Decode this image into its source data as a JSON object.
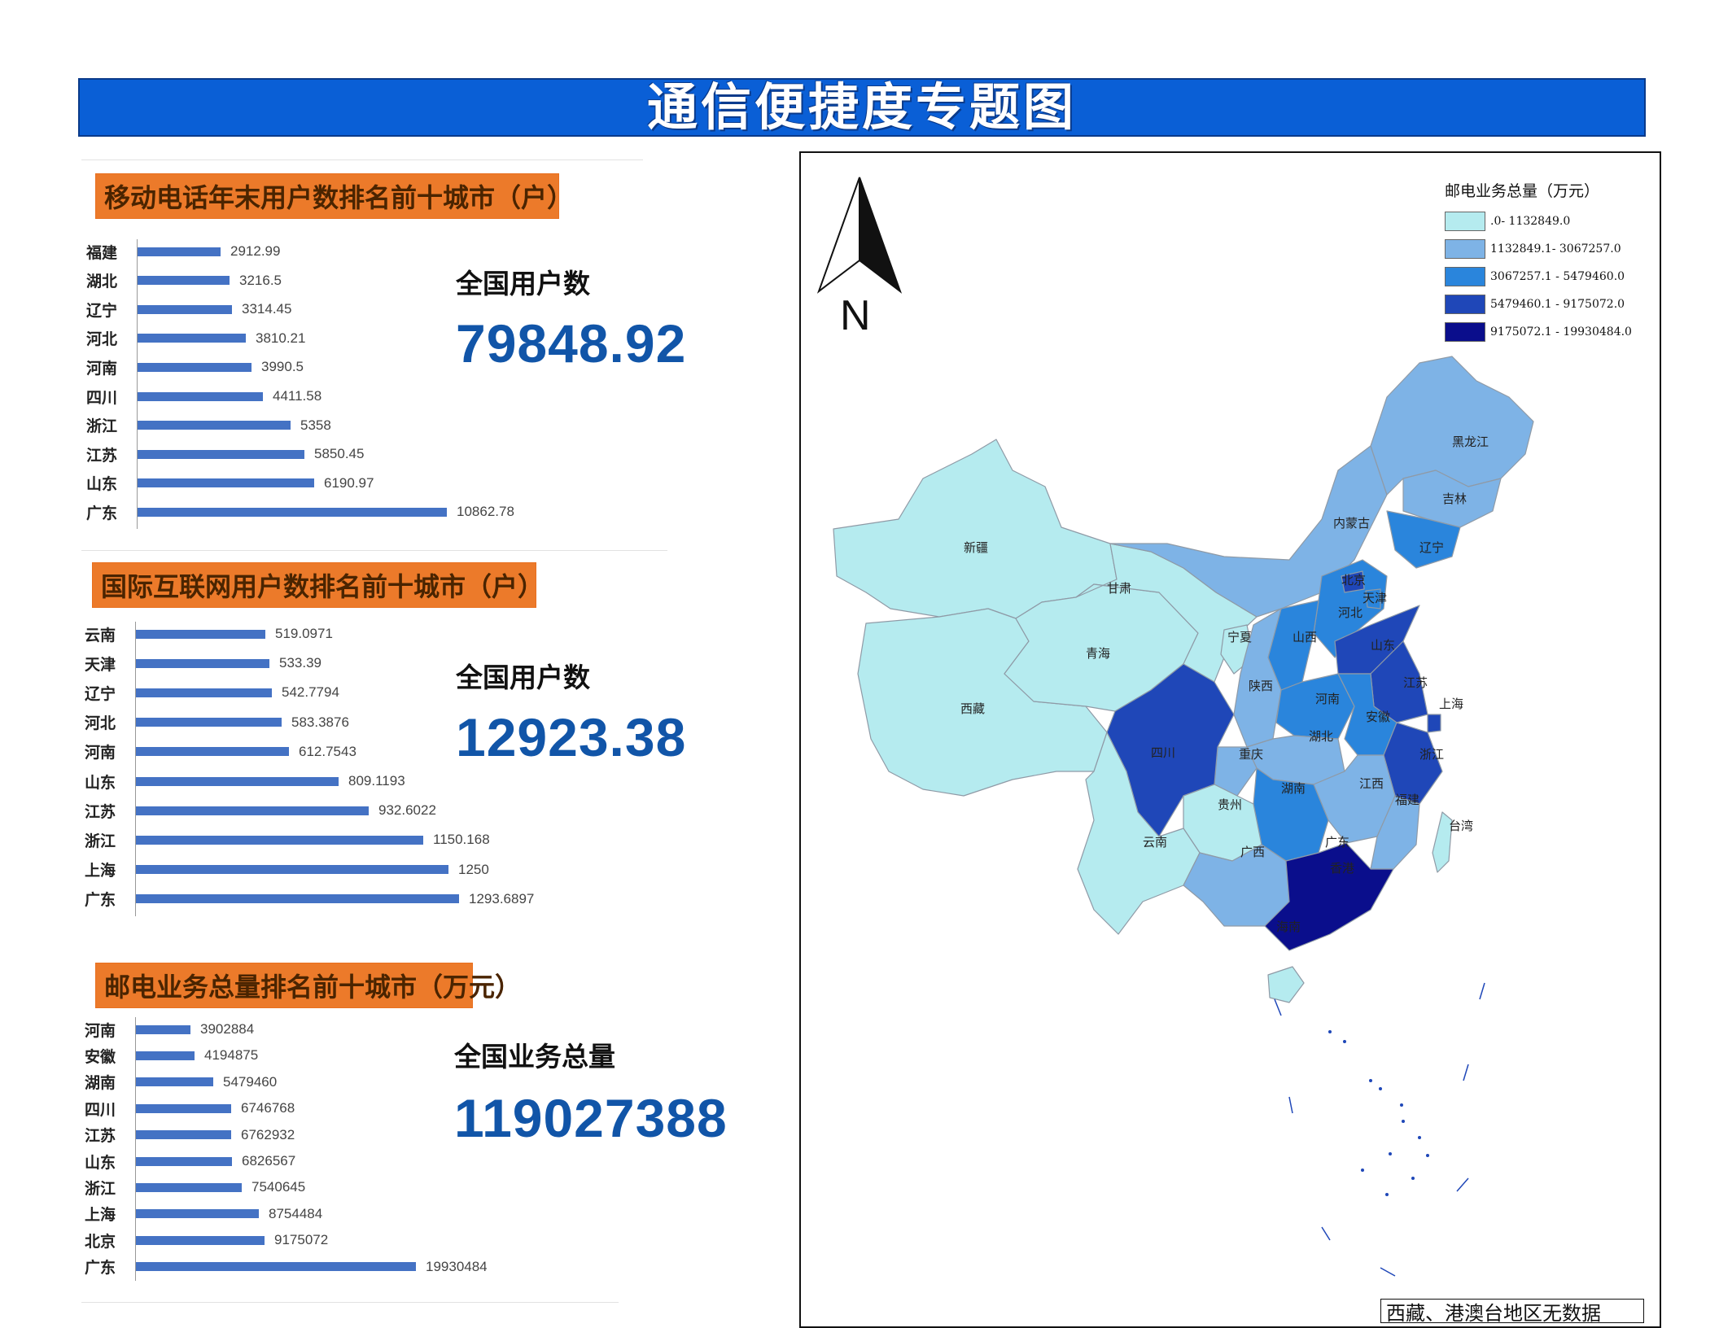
{
  "page_title": "通信便捷度专题图",
  "panels": [
    {
      "title": "移动电话年末用户数排名前十城市（户）",
      "total_label": "全国用户数",
      "total_value": "79848.92",
      "chart_data": {
        "type": "bar",
        "orientation": "horizontal",
        "categories": [
          "福建",
          "湖北",
          "辽宁",
          "河北",
          "河南",
          "四川",
          "浙江",
          "江苏",
          "山东",
          "广东"
        ],
        "values": [
          2912.99,
          3216.5,
          3314.45,
          3810.21,
          3990.5,
          4411.58,
          5358,
          5850.45,
          6190.97,
          10862.78
        ],
        "value_labels": [
          "2912.99",
          "3216.5",
          "3314.45",
          "3810.21",
          "3990.5",
          "4411.58",
          "5358",
          "5850.45",
          "6190.97",
          "10862.78"
        ],
        "xlim": [
          0,
          12000
        ],
        "color": "#4472c4"
      }
    },
    {
      "title": "国际互联网用户数排名前十城市（户）",
      "total_label": "全国用户数",
      "total_value": "12923.38",
      "chart_data": {
        "type": "bar",
        "orientation": "horizontal",
        "categories": [
          "云南",
          "天津",
          "辽宁",
          "河北",
          "河南",
          "山东",
          "江苏",
          "浙江",
          "上海",
          "广东"
        ],
        "values": [
          519.0971,
          533.39,
          542.7794,
          583.3876,
          612.7543,
          809.1193,
          932.6022,
          1150.168,
          1250,
          1293.6897
        ],
        "value_labels": [
          "519.0971",
          "533.39",
          "542.7794",
          "583.3876",
          "612.7543",
          "809.1193",
          "932.6022",
          "1150.168",
          "1250",
          "1293.6897"
        ],
        "xlim": [
          0,
          1400
        ],
        "color": "#4472c4"
      }
    },
    {
      "title": "邮电业务总量排名前十城市（万元）",
      "total_label": "全国业务总量",
      "total_value": "119027388",
      "chart_data": {
        "type": "bar",
        "orientation": "horizontal",
        "categories": [
          "河南",
          "安徽",
          "湖南",
          "四川",
          "江苏",
          "山东",
          "浙江",
          "上海",
          "北京",
          "广东"
        ],
        "values": [
          3902884,
          4194875,
          5479460,
          6746768,
          6762932,
          6826567,
          7540645,
          8754484,
          9175072,
          19930484
        ],
        "value_labels": [
          "3902884",
          "4194875",
          "5479460",
          "6746768",
          "6762932",
          "6826567",
          "7540645",
          "8754484",
          "9175072",
          "19930484"
        ],
        "xlim": [
          0,
          22000000
        ],
        "color": "#4472c4"
      }
    }
  ],
  "map": {
    "north_label": "N",
    "note": "西藏、港澳台地区无数据",
    "legend": {
      "title": "邮电业务总量（万元）",
      "items": [
        {
          "label": ".0- 1132849.0",
          "color": "#b5ebef"
        },
        {
          "label": "1132849.1- 3067257.0",
          "color": "#7eb3e6"
        },
        {
          "label": "3067257.1 - 5479460.0",
          "color": "#2a85dc"
        },
        {
          "label": "5479460.1 - 9175072.0",
          "color": "#1f47b8"
        },
        {
          "label": "9175072.1 - 19930484.0",
          "color": "#0a0e8c"
        }
      ]
    },
    "province_labels": [
      "黑龙江",
      "吉林",
      "辽宁",
      "内蒙古",
      "北京",
      "天津",
      "河北",
      "山西",
      "山东",
      "新疆",
      "甘肃",
      "宁夏",
      "青海",
      "陕西",
      "河南",
      "江苏",
      "上海",
      "安徽",
      "西藏",
      "四川",
      "重庆",
      "湖北",
      "浙江",
      "江西",
      "湖南",
      "贵州",
      "福建",
      "台湾",
      "云南",
      "广西",
      "广东",
      "香港",
      "海南"
    ]
  }
}
